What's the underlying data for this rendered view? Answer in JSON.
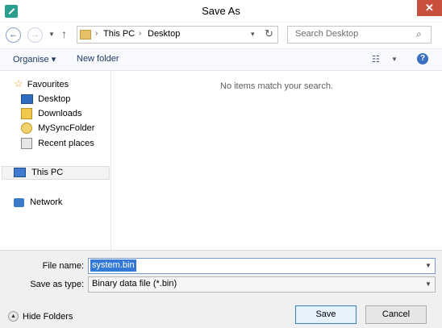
{
  "window": {
    "title": "Save As",
    "close_glyph": "✕"
  },
  "address": {
    "crumbs": [
      "This PC",
      "Desktop"
    ],
    "search_placeholder": "Search Desktop"
  },
  "toolbar": {
    "organise": "Organise ▾",
    "new_folder": "New folder"
  },
  "nav": {
    "favourites": "Favourites",
    "items": [
      "Desktop",
      "Downloads",
      "MySyncFolder",
      "Recent places"
    ],
    "this_pc": "This PC",
    "network": "Network"
  },
  "content": {
    "empty_message": "No items match your search."
  },
  "form": {
    "file_name_label": "File name:",
    "file_name_value": "system.bin",
    "save_type_label": "Save as type:",
    "save_type_value": "Binary data file (*.bin)"
  },
  "footer": {
    "hide_folders": "Hide Folders",
    "save": "Save",
    "cancel": "Cancel"
  },
  "colors": {
    "close_red": "#c7503f",
    "selection_blue": "#3378d7",
    "help_blue": "#3b6fc1"
  },
  "icons": [
    "app-icon",
    "close-icon",
    "back-icon",
    "forward-icon",
    "up-icon",
    "folder-icon",
    "refresh-icon",
    "search-icon",
    "view-icon",
    "help-icon",
    "star-icon",
    "desktop-icon",
    "downloads-icon",
    "sync-folder-icon",
    "recent-icon",
    "computer-icon",
    "network-icon",
    "chevron-up-icon"
  ]
}
